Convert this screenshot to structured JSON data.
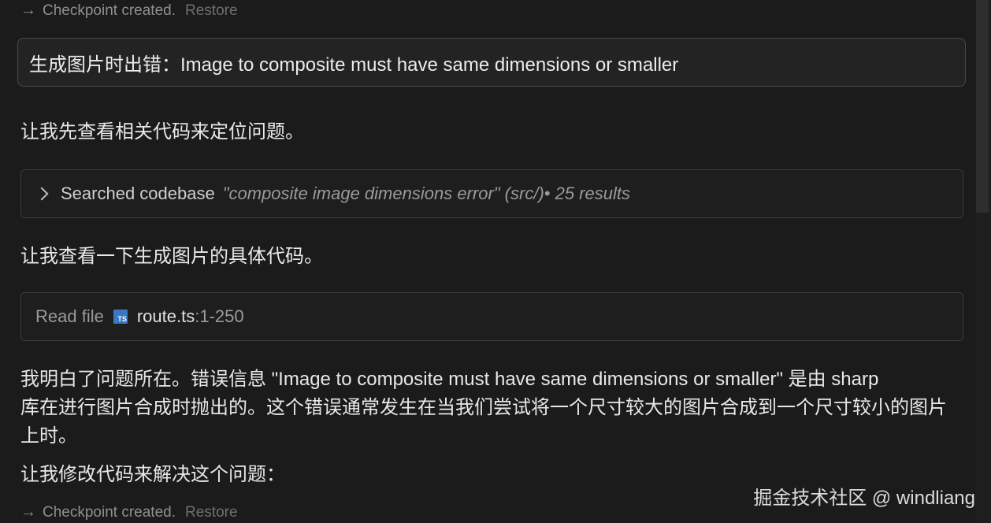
{
  "checkpoint_top": {
    "arrow": "→",
    "text": "Checkpoint created.",
    "restore": "Restore"
  },
  "user_message": "生成图片时出错：Image to composite must have same dimensions or smaller",
  "para1": "让我先查看相关代码来定位问题。",
  "search_tool": {
    "title": "Searched codebase",
    "query": "\"composite image dimensions error\" (src/)",
    "count": " • 25 results"
  },
  "para2": "让我查看一下生成图片的具体代码。",
  "read_tool": {
    "label": "Read file",
    "icon_text": "TS",
    "file": "route.ts",
    "range": ":1-250"
  },
  "para3": {
    "line1": "我明白了问题所在。错误信息 \"Image to composite must have same dimensions or smaller\" 是由 sharp",
    "line2": "库在进行图片合成时抛出的。这个错误通常发生在当我们尝试将一个尺寸较大的图片合成到一个尺寸较小的图片",
    "line3": "上时。"
  },
  "para4": "让我修改代码来解决这个问题：",
  "checkpoint_bottom": {
    "arrow": "→",
    "text": "Checkpoint created.",
    "restore": "Restore"
  },
  "watermark": "掘金技术社区 @ windliang"
}
